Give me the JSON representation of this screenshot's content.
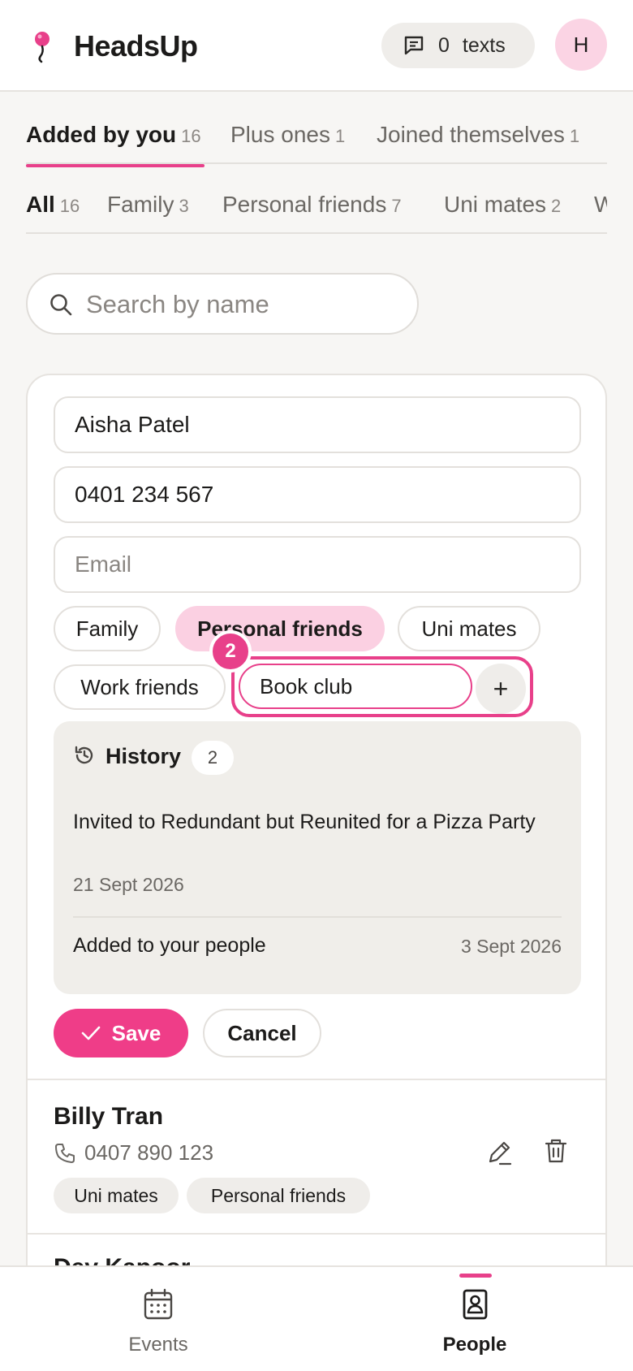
{
  "app": {
    "name": "HeadsUp",
    "avatar_initial": "H"
  },
  "header": {
    "texts_count": "0",
    "texts_label": "texts"
  },
  "tabs_primary": [
    {
      "label": "Added by you",
      "count": "16",
      "active": true
    },
    {
      "label": "Plus ones",
      "count": "1",
      "active": false
    },
    {
      "label": "Joined themselves",
      "count": "1",
      "active": false
    }
  ],
  "tabs_secondary": [
    {
      "label": "All",
      "count": "16",
      "active": true
    },
    {
      "label": "Family",
      "count": "3",
      "active": false
    },
    {
      "label": "Personal friends",
      "count": "7",
      "active": false
    },
    {
      "label": "Uni mates",
      "count": "2",
      "active": false
    },
    {
      "label": "W",
      "count": "",
      "active": false
    }
  ],
  "search": {
    "placeholder": "Search by name",
    "value": ""
  },
  "edit_form": {
    "name_value": "Aisha Patel",
    "phone_value": "0401 234 567",
    "email_placeholder": "Email",
    "email_value": "",
    "groups": [
      {
        "label": "Family",
        "selected": false
      },
      {
        "label": "Personal friends",
        "selected": true
      },
      {
        "label": "Uni mates",
        "selected": false
      },
      {
        "label": "Work friends",
        "selected": false
      }
    ],
    "new_group_value": "Book club",
    "add_symbol": "+",
    "step_badge": "2",
    "history": {
      "title": "History",
      "count": "2",
      "events": [
        {
          "text": "Invited to Redundant but Reunited for a Pizza Party",
          "date": "21 Sept 2026"
        },
        {
          "text": "Added to your people",
          "date": "3 Sept 2026"
        }
      ]
    },
    "save_label": "Save",
    "cancel_label": "Cancel"
  },
  "people": [
    {
      "name": "Billy Tran",
      "phone": "0407 890 123",
      "tags": [
        "Uni mates",
        "Personal friends"
      ]
    },
    {
      "name": "Dev Kapoor"
    }
  ],
  "bottom_nav": [
    {
      "label": "Events",
      "icon": "calendar-icon",
      "active": false
    },
    {
      "label": "People",
      "icon": "contacts-book-icon",
      "active": true
    }
  ],
  "colors": {
    "accent": "#e8408a",
    "save_button": "#ef3d88",
    "selected_chip": "#fbd0e2",
    "avatar_bg": "#fbd4e4"
  }
}
